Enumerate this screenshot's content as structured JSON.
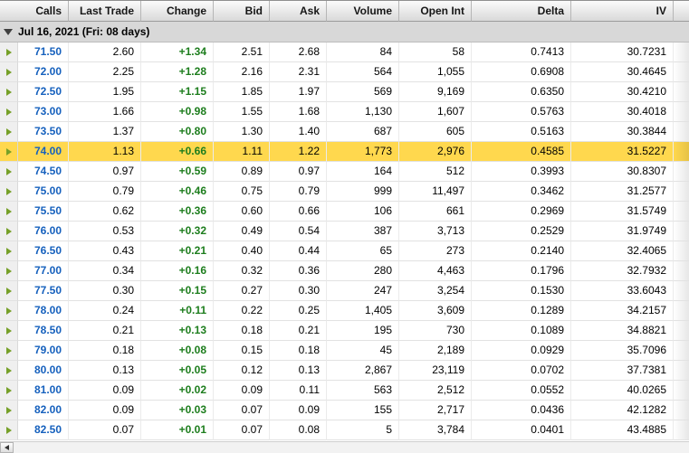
{
  "colors": {
    "strike_blue": "#1560bd",
    "change_green": "#1d7d1d",
    "highlight_yellow": "#ffd84e",
    "row_arrow_green": "#76a028",
    "group_triangle": "#3f3f3f"
  },
  "icons": {
    "group_collapse": "triangle-down-icon",
    "row_marker": "triangle-right-icon",
    "scroll_left": "triangle-left-icon"
  },
  "table": {
    "columns": [
      "Calls",
      "Last Trade",
      "Change",
      "Bid",
      "Ask",
      "Volume",
      "Open Int",
      "Delta",
      "IV"
    ],
    "group_header": "Jul 16, 2021 (Fri: 08 days)",
    "rows": [
      {
        "strike": "71.50",
        "last": "2.60",
        "change": "+1.34",
        "bid": "2.51",
        "ask": "2.68",
        "volume": "84",
        "open_int": "58",
        "delta": "0.7413",
        "iv": "30.7231",
        "highlight": false
      },
      {
        "strike": "72.00",
        "last": "2.25",
        "change": "+1.28",
        "bid": "2.16",
        "ask": "2.31",
        "volume": "564",
        "open_int": "1,055",
        "delta": "0.6908",
        "iv": "30.4645",
        "highlight": false
      },
      {
        "strike": "72.50",
        "last": "1.95",
        "change": "+1.15",
        "bid": "1.85",
        "ask": "1.97",
        "volume": "569",
        "open_int": "9,169",
        "delta": "0.6350",
        "iv": "30.4210",
        "highlight": false
      },
      {
        "strike": "73.00",
        "last": "1.66",
        "change": "+0.98",
        "bid": "1.55",
        "ask": "1.68",
        "volume": "1,130",
        "open_int": "1,607",
        "delta": "0.5763",
        "iv": "30.4018",
        "highlight": false
      },
      {
        "strike": "73.50",
        "last": "1.37",
        "change": "+0.80",
        "bid": "1.30",
        "ask": "1.40",
        "volume": "687",
        "open_int": "605",
        "delta": "0.5163",
        "iv": "30.3844",
        "highlight": false
      },
      {
        "strike": "74.00",
        "last": "1.13",
        "change": "+0.66",
        "bid": "1.11",
        "ask": "1.22",
        "volume": "1,773",
        "open_int": "2,976",
        "delta": "0.4585",
        "iv": "31.5227",
        "highlight": true
      },
      {
        "strike": "74.50",
        "last": "0.97",
        "change": "+0.59",
        "bid": "0.89",
        "ask": "0.97",
        "volume": "164",
        "open_int": "512",
        "delta": "0.3993",
        "iv": "30.8307",
        "highlight": false
      },
      {
        "strike": "75.00",
        "last": "0.79",
        "change": "+0.46",
        "bid": "0.75",
        "ask": "0.79",
        "volume": "999",
        "open_int": "11,497",
        "delta": "0.3462",
        "iv": "31.2577",
        "highlight": false
      },
      {
        "strike": "75.50",
        "last": "0.62",
        "change": "+0.36",
        "bid": "0.60",
        "ask": "0.66",
        "volume": "106",
        "open_int": "661",
        "delta": "0.2969",
        "iv": "31.5749",
        "highlight": false
      },
      {
        "strike": "76.00",
        "last": "0.53",
        "change": "+0.32",
        "bid": "0.49",
        "ask": "0.54",
        "volume": "387",
        "open_int": "3,713",
        "delta": "0.2529",
        "iv": "31.9749",
        "highlight": false
      },
      {
        "strike": "76.50",
        "last": "0.43",
        "change": "+0.21",
        "bid": "0.40",
        "ask": "0.44",
        "volume": "65",
        "open_int": "273",
        "delta": "0.2140",
        "iv": "32.4065",
        "highlight": false
      },
      {
        "strike": "77.00",
        "last": "0.34",
        "change": "+0.16",
        "bid": "0.32",
        "ask": "0.36",
        "volume": "280",
        "open_int": "4,463",
        "delta": "0.1796",
        "iv": "32.7932",
        "highlight": false
      },
      {
        "strike": "77.50",
        "last": "0.30",
        "change": "+0.15",
        "bid": "0.27",
        "ask": "0.30",
        "volume": "247",
        "open_int": "3,254",
        "delta": "0.1530",
        "iv": "33.6043",
        "highlight": false
      },
      {
        "strike": "78.00",
        "last": "0.24",
        "change": "+0.11",
        "bid": "0.22",
        "ask": "0.25",
        "volume": "1,405",
        "open_int": "3,609",
        "delta": "0.1289",
        "iv": "34.2157",
        "highlight": false
      },
      {
        "strike": "78.50",
        "last": "0.21",
        "change": "+0.13",
        "bid": "0.18",
        "ask": "0.21",
        "volume": "195",
        "open_int": "730",
        "delta": "0.1089",
        "iv": "34.8821",
        "highlight": false
      },
      {
        "strike": "79.00",
        "last": "0.18",
        "change": "+0.08",
        "bid": "0.15",
        "ask": "0.18",
        "volume": "45",
        "open_int": "2,189",
        "delta": "0.0929",
        "iv": "35.7096",
        "highlight": false
      },
      {
        "strike": "80.00",
        "last": "0.13",
        "change": "+0.05",
        "bid": "0.12",
        "ask": "0.13",
        "volume": "2,867",
        "open_int": "23,119",
        "delta": "0.0702",
        "iv": "37.7381",
        "highlight": false
      },
      {
        "strike": "81.00",
        "last": "0.09",
        "change": "+0.02",
        "bid": "0.09",
        "ask": "0.11",
        "volume": "563",
        "open_int": "2,512",
        "delta": "0.0552",
        "iv": "40.0265",
        "highlight": false
      },
      {
        "strike": "82.00",
        "last": "0.09",
        "change": "+0.03",
        "bid": "0.07",
        "ask": "0.09",
        "volume": "155",
        "open_int": "2,717",
        "delta": "0.0436",
        "iv": "42.1282",
        "highlight": false
      },
      {
        "strike": "82.50",
        "last": "0.07",
        "change": "+0.01",
        "bid": "0.07",
        "ask": "0.08",
        "volume": "5",
        "open_int": "3,784",
        "delta": "0.0401",
        "iv": "43.4885",
        "highlight": false
      }
    ]
  }
}
